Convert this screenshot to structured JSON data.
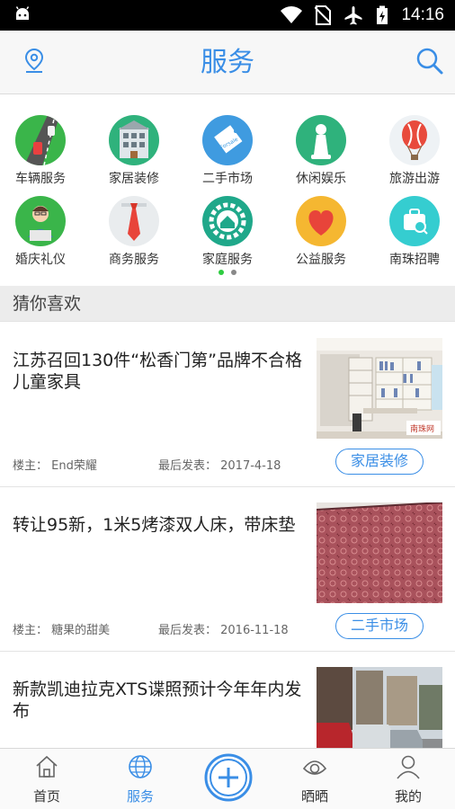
{
  "status_bar": {
    "time": "14:16"
  },
  "header": {
    "title": "服务",
    "location_icon": "location-pin-icon",
    "search_icon": "search-icon"
  },
  "categories": [
    {
      "label": "车辆服务",
      "icon": "road-car-icon"
    },
    {
      "label": "家居装修",
      "icon": "building-icon"
    },
    {
      "label": "二手市场",
      "icon": "price-tag-icon"
    },
    {
      "label": "休闲娱乐",
      "icon": "chess-pawn-icon"
    },
    {
      "label": "旅游出游",
      "icon": "hot-air-balloon-icon"
    },
    {
      "label": "婚庆礼仪",
      "icon": "person-laptop-icon"
    },
    {
      "label": "商务服务",
      "icon": "necktie-icon"
    },
    {
      "label": "家庭服务",
      "icon": "house-gear-icon"
    },
    {
      "label": "公益服务",
      "icon": "heart-icon"
    },
    {
      "label": "南珠招聘",
      "icon": "briefcase-icon"
    }
  ],
  "pager": {
    "page_count": 2,
    "active_page": 1
  },
  "section_title": "猜你喜欢",
  "posts": [
    {
      "title": "江苏召回130件“松香门第”品牌不合格儿童家具",
      "owner": "楼主：  End荣耀",
      "last_post": "最后发表：  2017-4-18",
      "tag": "家居装修",
      "thumb_watermark": "南珠网"
    },
    {
      "title": "转让95新，1米5烤漆双人床，带床垫",
      "owner": "楼主：  糖果的甜美",
      "last_post": "最后发表：  2016-11-18",
      "tag": "二手市场",
      "thumb_watermark": ""
    },
    {
      "title": "新款凯迪拉克XTS谍照预计今年年内发布",
      "owner": "",
      "last_post": "",
      "tag": "",
      "thumb_watermark": ""
    }
  ],
  "tabs": [
    {
      "label": "首页",
      "icon": "home-icon",
      "active": false
    },
    {
      "label": "服务",
      "icon": "globe-icon",
      "active": true
    },
    {
      "label": "",
      "icon": "plus-icon",
      "active": false
    },
    {
      "label": "晒晒",
      "icon": "eye-icon",
      "active": false
    },
    {
      "label": "我的",
      "icon": "user-icon",
      "active": false
    }
  ],
  "colors": {
    "accent": "#3a8ee6",
    "header_bg": "#f7f7f7",
    "section_bg": "#ececec",
    "pager_active": "#2ecc40",
    "pager_inactive": "#888888"
  }
}
